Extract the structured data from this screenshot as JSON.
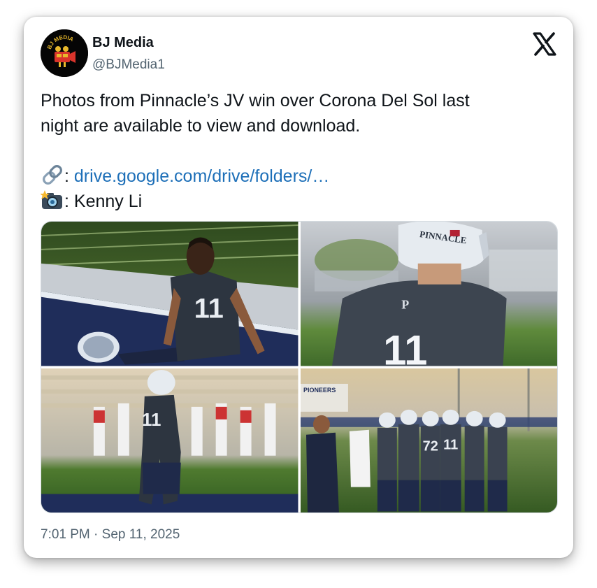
{
  "author": {
    "name": "BJ Media",
    "handle": "@BJMedia1",
    "avatar_text": "BJ MEDIA"
  },
  "platform_icon": "x-logo-icon",
  "tweet": {
    "line1": "Photos from Pinnacle’s JV win over Corona Del Sol last",
    "line2": "night are available to view and download.",
    "link_prefix": ": ",
    "link_text": "drive.google.com/drive/folders/…",
    "credit_prefix": ": ",
    "credit_text": "Kenny Li"
  },
  "icons": {
    "link": "link-icon",
    "camera": "camera-flash-icon"
  },
  "photos": [
    {
      "jersey": "11"
    },
    {
      "jersey": "11",
      "helmet_text": "PINNACLE",
      "back_letter": "P"
    },
    {
      "jersey": "11"
    },
    {
      "jersey": "72",
      "jersey_2": "11",
      "sign_text": "PIONEERS"
    }
  ],
  "timestamp": "7:01 PM · Sep 11, 2025",
  "colors": {
    "link": "#1d6fb8",
    "text": "#0f1419",
    "muted": "#536471"
  }
}
